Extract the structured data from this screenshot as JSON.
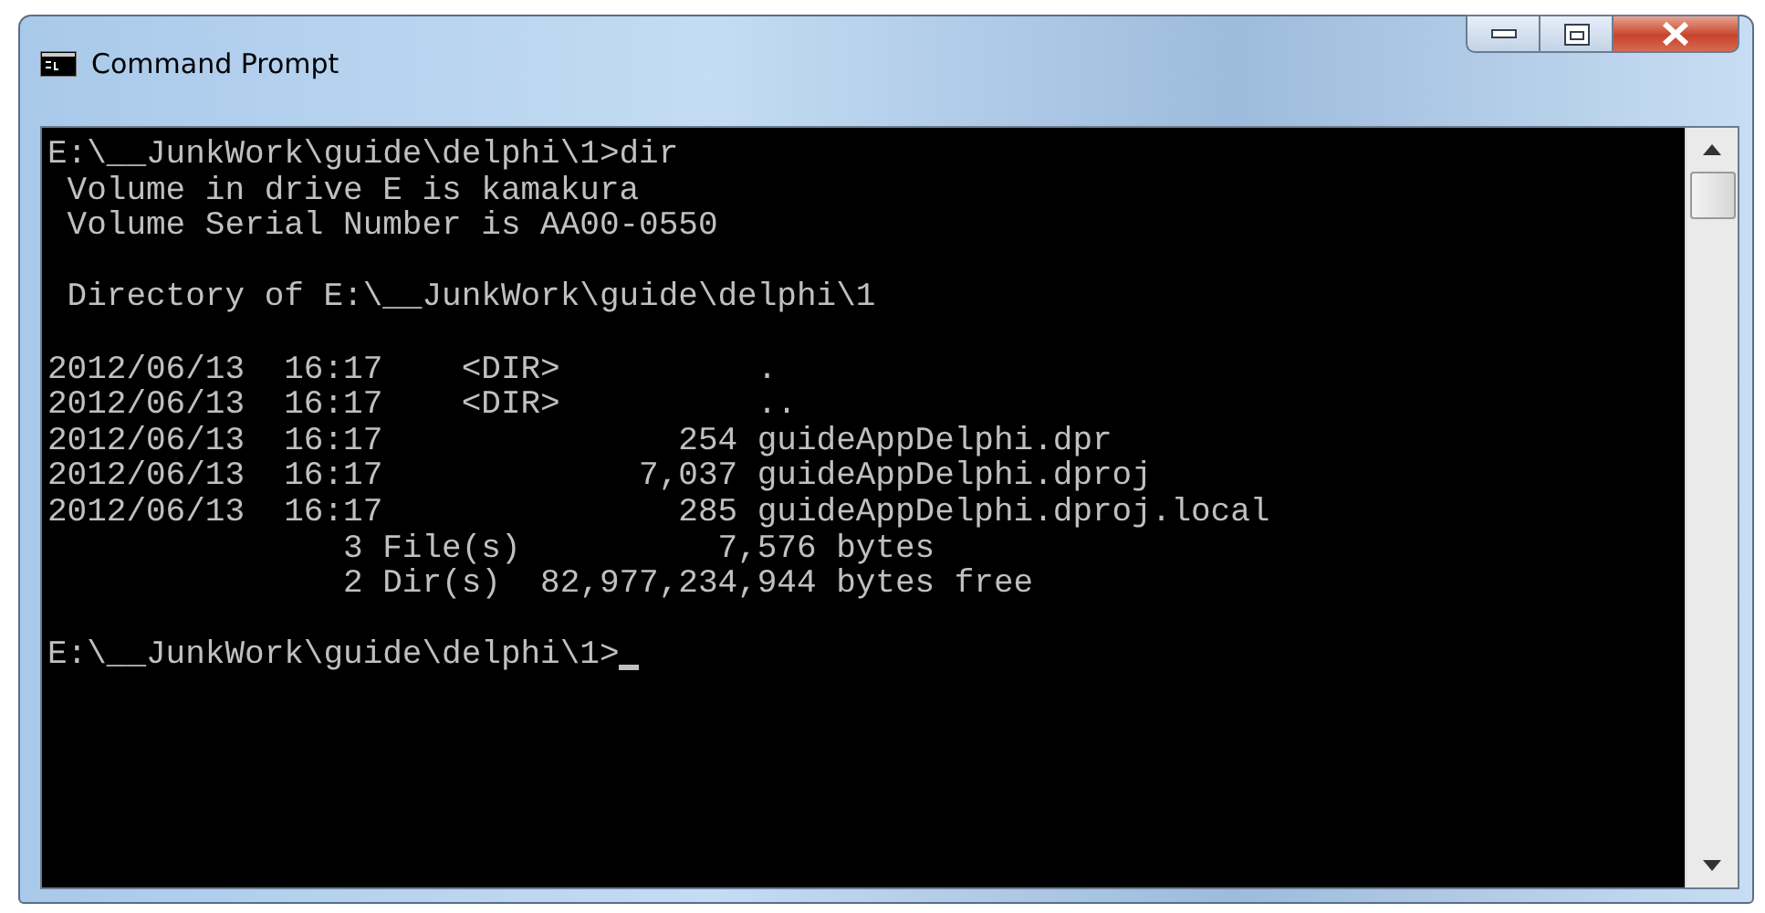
{
  "window": {
    "title": "Command Prompt"
  },
  "console": {
    "blocks": [
      [
        "E:\\__JunkWork\\guide\\delphi\\1>dir",
        " Volume in drive E is kamakura",
        " Volume Serial Number is AA00-0550"
      ],
      [
        " Directory of E:\\__JunkWork\\guide\\delphi\\1"
      ],
      [
        "2012/06/13  16:17    <DIR>          .",
        "2012/06/13  16:17    <DIR>          ..",
        "2012/06/13  16:17               254 guideAppDelphi.dpr",
        "2012/06/13  16:17             7,037 guideAppDelphi.dproj",
        "2012/06/13  16:17               285 guideAppDelphi.dproj.local",
        "               3 File(s)          7,576 bytes",
        "               2 Dir(s)  82,977,234,944 bytes free"
      ],
      [
        "E:\\__JunkWork\\guide\\delphi\\1>"
      ]
    ],
    "cursor_visible": true
  }
}
